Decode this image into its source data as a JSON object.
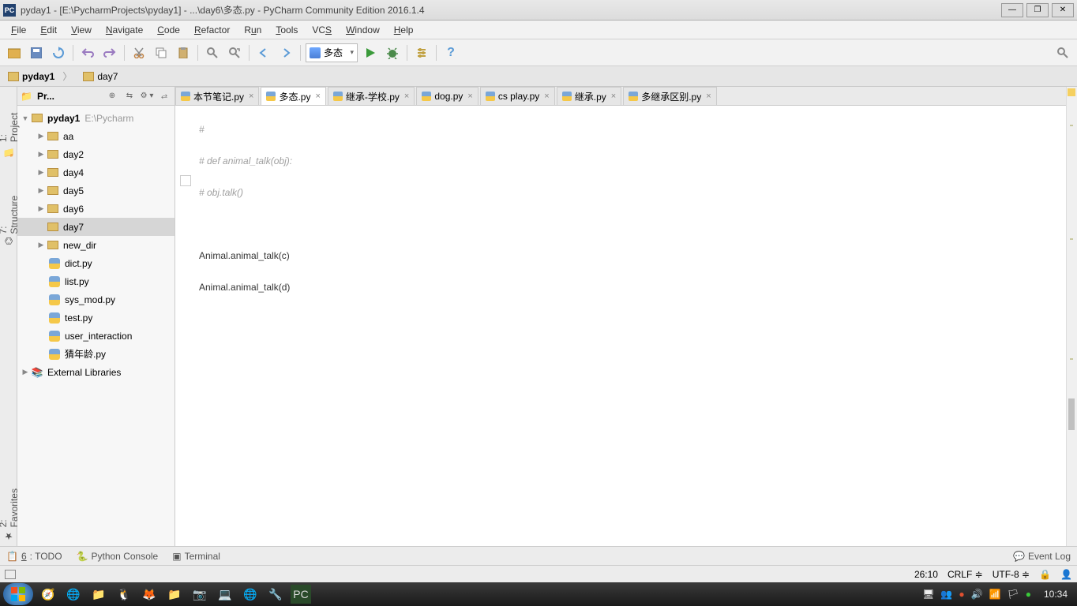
{
  "window": {
    "title": "pyday1 - [E:\\PycharmProjects\\pyday1] - ...\\day6\\多态.py - PyCharm Community Edition 2016.1.4"
  },
  "menu": [
    "File",
    "Edit",
    "View",
    "Navigate",
    "Code",
    "Refactor",
    "Run",
    "Tools",
    "VCS",
    "Window",
    "Help"
  ],
  "run_config": "多态",
  "breadcrumbs": [
    "pyday1",
    "day7"
  ],
  "sidebar_tabs": {
    "project": "1: Project",
    "structure": "7: Structure",
    "favorites": "2: Favorites"
  },
  "project_panel": {
    "header": "Pr...",
    "root": "pyday1",
    "root_hint": "E:\\Pycharm",
    "folders": [
      "aa",
      "day2",
      "day4",
      "day5",
      "day6",
      "day7",
      "new_dir"
    ],
    "selected": "day7",
    "files": [
      "dict.py",
      "list.py",
      "sys_mod.py",
      "test.py",
      "user_interaction",
      "猜年龄.py"
    ],
    "external": "External Libraries"
  },
  "tabs": [
    {
      "label": "本节笔记.py"
    },
    {
      "label": "多态.py",
      "active": true
    },
    {
      "label": "继承-学校.py"
    },
    {
      "label": "dog.py"
    },
    {
      "label": "cs play.py"
    },
    {
      "label": "继承.py"
    },
    {
      "label": "多继承区别.py"
    }
  ],
  "code_lines": [
    {
      "text": "#",
      "cls": "cmnt"
    },
    {
      "text": "# def animal_talk(obj):",
      "cls": "cmnt"
    },
    {
      "text": "#     obj.talk()",
      "cls": "cmnt"
    },
    {
      "text": "",
      "cls": ""
    },
    {
      "text": "Animal.animal_talk(c)",
      "cls": ""
    },
    {
      "text": "Animal.animal_talk(d)",
      "cls": ""
    }
  ],
  "bottom_tabs": {
    "todo": "6: TODO",
    "python_console": "Python Console",
    "terminal": "Terminal",
    "event_log": "Event Log"
  },
  "status": {
    "pos": "26:10",
    "line_sep": "CRLF ≑",
    "encoding": "UTF-8 ≑"
  },
  "taskbar_time": "10:34"
}
